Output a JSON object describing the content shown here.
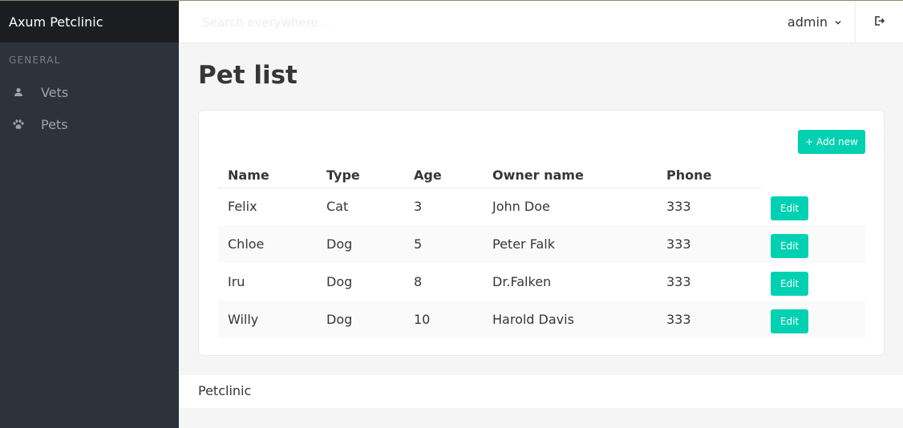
{
  "app": {
    "brand": "Axum Petclinic"
  },
  "header": {
    "search_placeholder": "Search everywhere...",
    "user_label": "admin"
  },
  "sidebar": {
    "section_label": "GENERAL",
    "items": [
      {
        "label": "Vets",
        "icon": "user-icon"
      },
      {
        "label": "Pets",
        "icon": "paw-icon"
      }
    ]
  },
  "main": {
    "title": "Pet list",
    "add_button_label": "+ Add new",
    "columns": [
      "Name",
      "Type",
      "Age",
      "Owner name",
      "Phone"
    ],
    "rows": [
      {
        "name": "Felix",
        "type": "Cat",
        "age": "3",
        "owner": "John Doe",
        "phone": "333",
        "action": "Edit"
      },
      {
        "name": "Chloe",
        "type": "Dog",
        "age": "5",
        "owner": "Peter Falk",
        "phone": "333",
        "action": "Edit"
      },
      {
        "name": "Iru",
        "type": "Dog",
        "age": "8",
        "owner": "Dr.Falken",
        "phone": "333",
        "action": "Edit"
      },
      {
        "name": "Willy",
        "type": "Dog",
        "age": "10",
        "owner": "Harold Davis",
        "phone": "333",
        "action": "Edit"
      }
    ]
  },
  "footer": {
    "text": "Petclinic"
  },
  "colors": {
    "accent": "#00d1b2",
    "sidebar": "#2e323a",
    "brand_bg": "#1c1d21"
  }
}
